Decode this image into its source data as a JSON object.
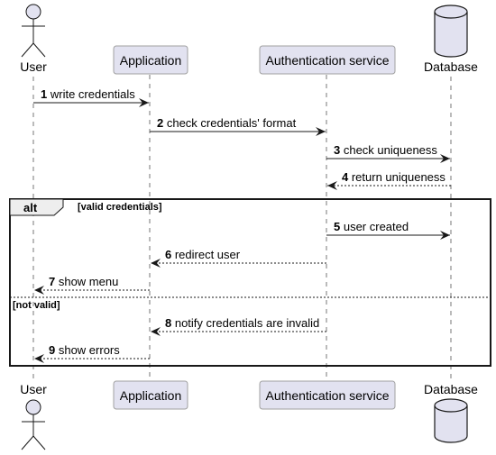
{
  "diagram": {
    "type": "sequence",
    "participants": [
      {
        "id": "user",
        "name": "User",
        "kind": "actor"
      },
      {
        "id": "app",
        "name": "Application",
        "kind": "participant"
      },
      {
        "id": "auth",
        "name": "Authentication service",
        "kind": "participant"
      },
      {
        "id": "db",
        "name": "Database",
        "kind": "database"
      }
    ],
    "messages": [
      {
        "num": "1",
        "text": "write credentials",
        "from": "user",
        "to": "app",
        "style": "solid"
      },
      {
        "num": "2",
        "text": "check credentials' format",
        "from": "app",
        "to": "auth",
        "style": "solid"
      },
      {
        "num": "3",
        "text": "check uniqueness",
        "from": "auth",
        "to": "db",
        "style": "solid"
      },
      {
        "num": "4",
        "text": "return uniqueness",
        "from": "db",
        "to": "auth",
        "style": "dashed"
      },
      {
        "num": "5",
        "text": "user created",
        "from": "auth",
        "to": "db",
        "style": "solid"
      },
      {
        "num": "6",
        "text": "redirect user",
        "from": "auth",
        "to": "app",
        "style": "dashed"
      },
      {
        "num": "7",
        "text": "show menu",
        "from": "app",
        "to": "user",
        "style": "dashed"
      },
      {
        "num": "8",
        "text": "notify credentials are invalid",
        "from": "auth",
        "to": "app",
        "style": "dashed"
      },
      {
        "num": "9",
        "text": "show errors",
        "from": "app",
        "to": "user",
        "style": "dashed"
      }
    ],
    "fragment": {
      "label": "alt",
      "sections": [
        {
          "guard": "[valid credentials]",
          "messages": [
            "5",
            "6",
            "7"
          ]
        },
        {
          "guard": "[not valid]",
          "messages": [
            "8",
            "9"
          ]
        }
      ]
    },
    "colors": {
      "participant_fill": "#E2E2F0",
      "participant_border": "#A0A0A0",
      "line": "#181818",
      "lifeline": "#555555",
      "fragment_header_fill": "#EEEEEE"
    }
  }
}
